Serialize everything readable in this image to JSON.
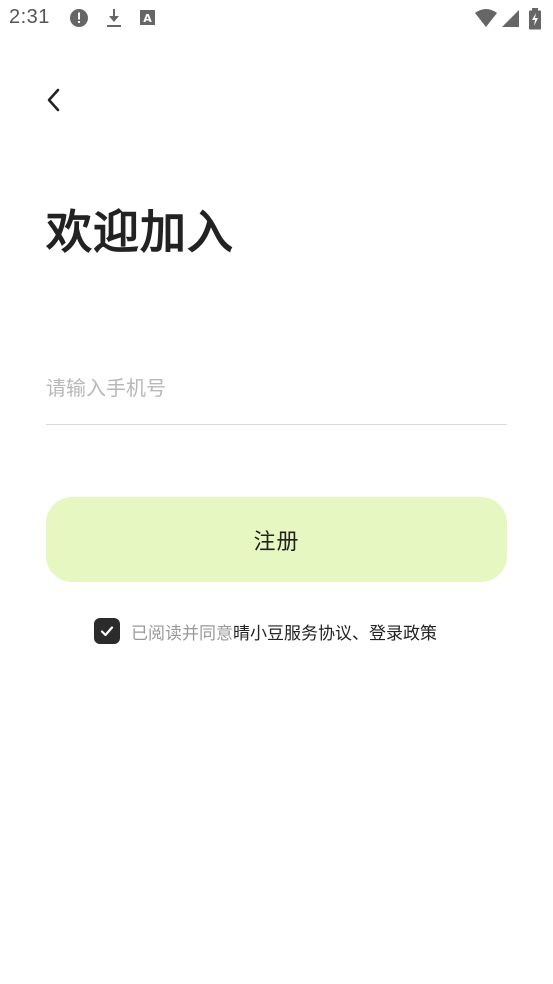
{
  "status_bar": {
    "time": "2:31",
    "icons": [
      "alert-icon",
      "download-icon",
      "font-icon",
      "wifi-icon",
      "signal-icon",
      "battery-charging-icon"
    ]
  },
  "nav": {
    "back_icon": "chevron-left-icon"
  },
  "page": {
    "title": "欢迎加入"
  },
  "form": {
    "phone_placeholder": "请输入手机号",
    "phone_value": ""
  },
  "actions": {
    "register_label": "注册"
  },
  "agreement": {
    "checked": true,
    "prefix": "已阅读并同意",
    "service_link": "晴小豆服务协议",
    "separator": "、",
    "policy_link": "登录政策"
  },
  "colors": {
    "register_button_bg": "#e6f7c2",
    "checkbox_bg": "#2b2b2b",
    "muted_text": "#999999",
    "placeholder_text": "#b8b8b8"
  }
}
